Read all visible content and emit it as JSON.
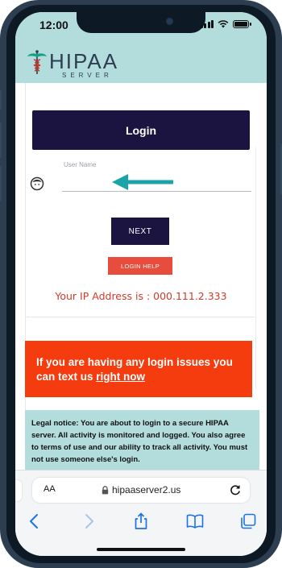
{
  "status_bar": {
    "time": "12:00"
  },
  "logo": {
    "brand": "HIPAA",
    "tagline": "SERVER"
  },
  "login": {
    "header": "Login",
    "username_label": "User Name",
    "username_value": "",
    "next_label": "NEXT",
    "help_label": "LOGIN HELP",
    "ip_text": "Your IP Address is : 000.111.2.333"
  },
  "alert": {
    "text": "If you are having any login issues you can text us",
    "link": "right now"
  },
  "legal": {
    "text": "Legal notice: You are about to login to a secure HIPAA server. All activity is monitored and logged. You also agree to terms of use and our ability to track all activity. You must not use someone else's login."
  },
  "browser": {
    "text_size_label": "AA",
    "url": "hipaaserver2.us"
  },
  "colors": {
    "header_bg": "#b3dcdc",
    "primary_dark": "#1b1440",
    "help_red": "#e74c3c",
    "alert_orange": "#f43c0e",
    "ip_red": "#d23a2a",
    "arrow_teal": "#1aa3a8",
    "ios_blue": "#1a73e8"
  },
  "icons": {
    "logo": "caduceus-icon",
    "user": "user-avatar-icon",
    "pointer": "arrow-left-icon",
    "lock": "lock-icon",
    "reload": "reload-icon",
    "back": "chevron-left-icon",
    "forward": "chevron-right-icon",
    "share": "share-icon",
    "bookmarks": "book-icon",
    "tabs": "tabs-icon"
  }
}
